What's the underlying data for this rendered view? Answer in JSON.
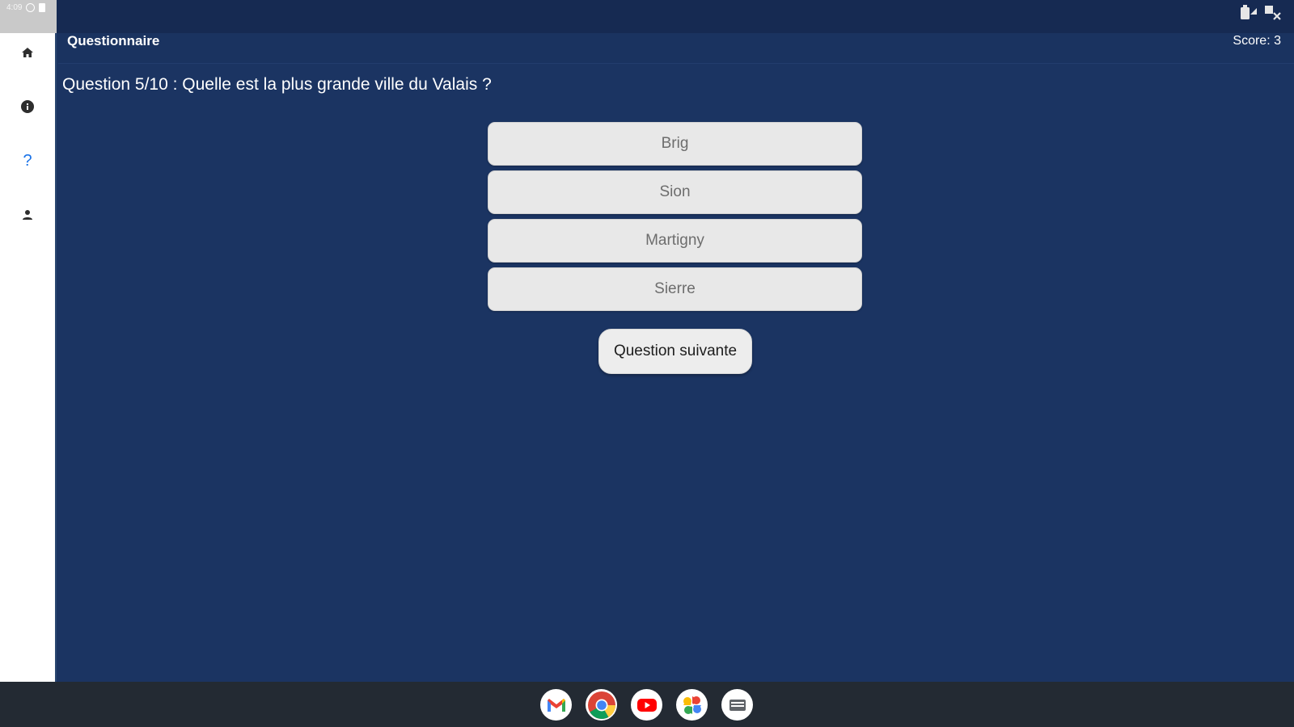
{
  "status_bar": {
    "time": "4:09"
  },
  "sidebar": {
    "items": [
      {
        "icon": "home-icon"
      },
      {
        "icon": "info-icon"
      },
      {
        "icon": "help-icon",
        "label": "?",
        "active": true
      },
      {
        "icon": "person-icon"
      }
    ]
  },
  "header": {
    "title": "Questionnaire",
    "score": "Score: 3"
  },
  "quiz": {
    "question": "Question 5/10 : Quelle est la plus grande ville du Valais ?",
    "answers": [
      "Brig",
      "Sion",
      "Martigny",
      "Sierre"
    ],
    "next_label": "Question suivante"
  },
  "taskbar": {
    "apps": [
      "gmail-icon",
      "chrome-icon",
      "youtube-icon",
      "photos-icon",
      "files-icon"
    ]
  },
  "colors": {
    "background": "#1b3462",
    "accent": "#1a73e8",
    "button": "#e8e8e8"
  }
}
